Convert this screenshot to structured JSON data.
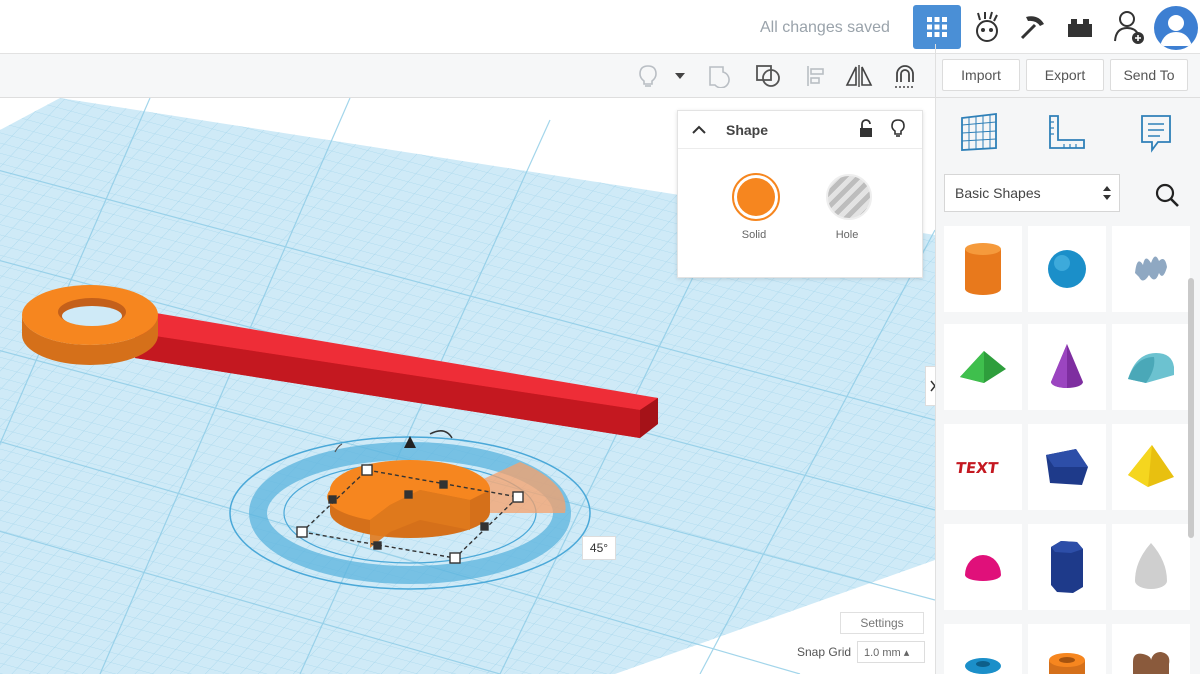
{
  "topbar": {
    "save_status": "All changes saved",
    "icons": [
      "grid-view-icon",
      "tinkercad-character-icon",
      "pickaxe-icon",
      "brick-icon",
      "add-user-icon",
      "avatar"
    ]
  },
  "toolbar": {
    "import_label": "Import",
    "export_label": "Export",
    "sendto_label": "Send To"
  },
  "shape_panel": {
    "title": "Shape",
    "solid_label": "Solid",
    "hole_label": "Hole",
    "solid_color": "#f6861f"
  },
  "sidebar": {
    "category": "Basic Shapes",
    "shapes": [
      "Cylinder",
      "Sphere",
      "Scribble",
      "Roof",
      "Cone",
      "Round Roof",
      "Text",
      "Polygon",
      "Pyramid",
      "Half Sphere",
      "Hexagonal Prism",
      "Paraboloid",
      "Torus",
      "Tube",
      "Heart"
    ]
  },
  "workplane": {
    "angle_readout": "45°",
    "settings_label": "Settings",
    "snap_grid_label": "Snap Grid",
    "snap_grid_value": "1.0 mm ▴"
  },
  "colors": {
    "accent": "#4a8fd6",
    "grid": "#bfe3f3",
    "orange": "#f6861f",
    "red": "#e41f2a"
  }
}
